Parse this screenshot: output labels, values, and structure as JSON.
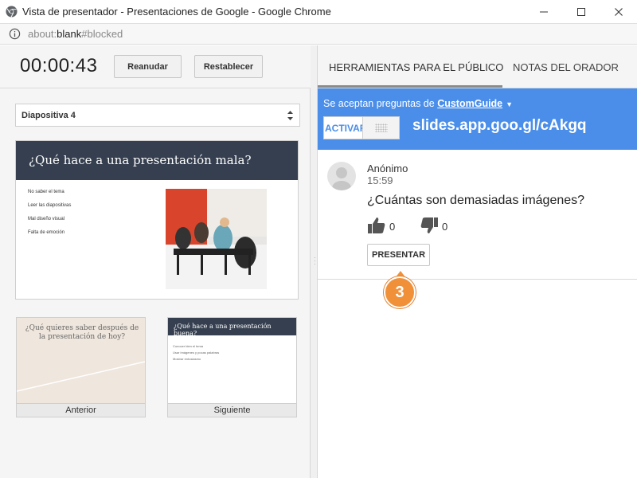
{
  "window": {
    "title": "Vista de presentador - Presentaciones de Google - Google Chrome"
  },
  "address": {
    "prefix": "about:",
    "host": "blank",
    "suffix": "#blocked"
  },
  "controls": {
    "timer": "00:00:43",
    "resume_label": "Reanudar",
    "reset_label": "Restablecer"
  },
  "slide_selector": {
    "selected": "Diapositiva 4"
  },
  "current_slide": {
    "title": "¿Qué hace a una presentación mala?",
    "bullets": [
      "No saber el tema",
      "Leer las diapositivas",
      "Mal diseño visual",
      "Falta de emoción"
    ]
  },
  "prev_slide": {
    "text": "¿Qué quieres saber después de la presentación de hoy?",
    "label": "Anterior"
  },
  "next_slide": {
    "title": "¿Qué hace a una presentación buena?",
    "lines": [
      "Conocer bien el tema",
      "Usar imágenes y pocas palabras",
      "Mostrar entusiasmo"
    ],
    "label": "Siguiente"
  },
  "tabs": {
    "audience": "HERRAMIENTAS PARA EL PÚBLICO",
    "notes": "NOTAS DEL ORADOR"
  },
  "qa": {
    "accepting_text": "Se aceptan preguntas de",
    "accepting_link": "CustomGuide",
    "toggle_on": "ACTIVAR",
    "short_url": "slides.app.goo.gl/cAkgq",
    "accent_color": "#4a8ee9"
  },
  "question": {
    "author": "Anónimo",
    "time": "15:59",
    "text": "¿Cuántas son demasiadas imágenes?",
    "upvotes": "0",
    "downvotes": "0",
    "present_label": "PRESENTAR"
  },
  "step_badge": "3"
}
